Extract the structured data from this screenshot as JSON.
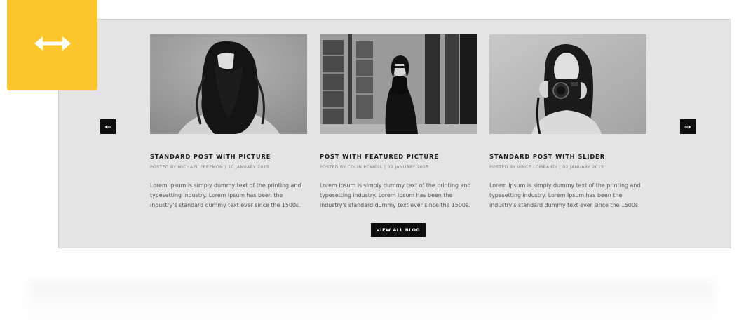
{
  "icons": {
    "badge": "horizontal-resize-arrows-icon",
    "prev": "arrow-left-icon",
    "next": "arrow-right-icon"
  },
  "colors": {
    "badge": "#fcc72c",
    "panel": "#e4e4e4",
    "button": "#0d0d0d",
    "button_text": "#ffffff"
  },
  "posts": [
    {
      "title": "STANDARD POST WITH PICTURE",
      "meta": "POSTED BY MICHAEL FREEMON | 10 JANUARY 2015",
      "excerpt": "Lorem Ipsum is simply dummy text of the printing and typesetting industry. Lorem Ipsum has been the industry's standard dummy text ever since the 1500s."
    },
    {
      "title": "POST WITH FEATURED PICTURE",
      "meta": "POSTED BY COLIN POWELL | 02 JANUARY 2015",
      "excerpt": "Lorem Ipsum is simply dummy text of the printing and typesetting industry. Lorem Ipsum has been the industry's standard dummy text ever since the 1500s."
    },
    {
      "title": "STANDARD POST WITH SLIDER",
      "meta": "POSTED BY VINCE LOMBARDI | 02 JANUARY 2015",
      "excerpt": "Lorem Ipsum is simply dummy text of the printing and typesetting industry. Lorem Ipsum has been the industry's standard dummy text ever since the 1500s."
    }
  ],
  "view_all_label": "VIEW ALL BLOG"
}
